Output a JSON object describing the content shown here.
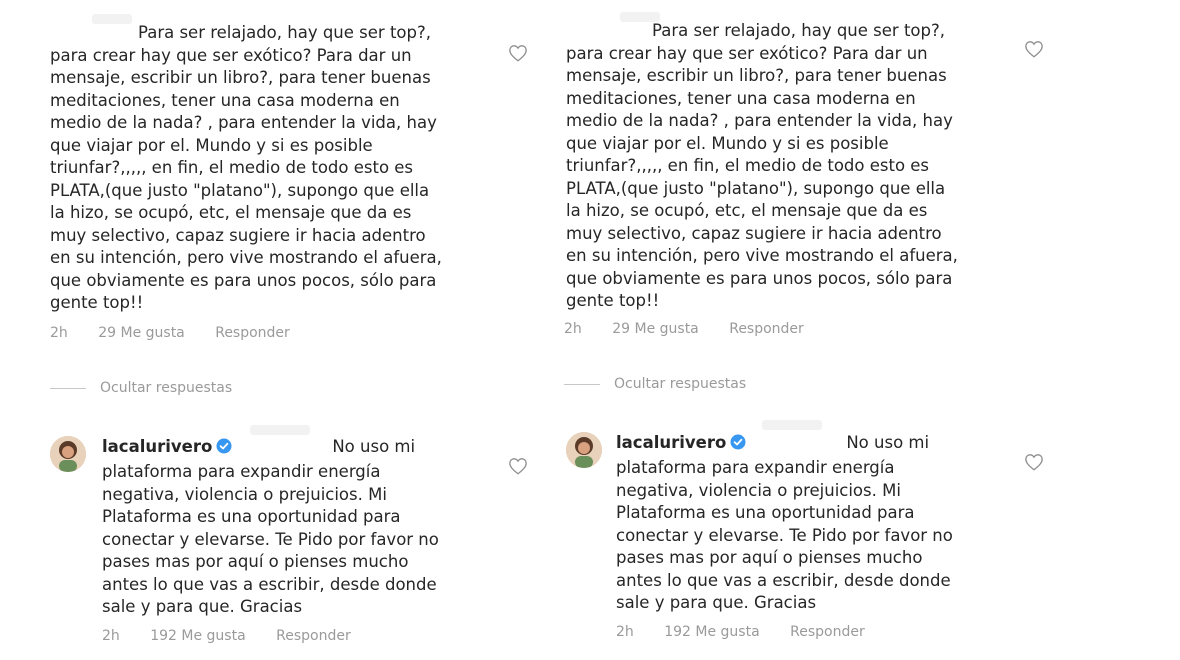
{
  "comment": {
    "intro": "Para ser relajado, hay que ser top?,",
    "text": "para crear hay que ser exótico? Para dar un\nmensaje, escribir un libro?, para tener buenas\nmeditaciones, tener una casa moderna en\nmedio de la nada? , para entender la vida, hay\nque viajar por el. Mundo y si es posible\ntriunfar?,,,,, en fin, el medio de todo esto es\nPLATA,(que justo \"platano\"), supongo que ella\nla hizo, se ocupó, etc, el mensaje que da es\nmuy selectivo, capaz sugiere ir hacia adentro\nen su intención, pero vive mostrando el afuera,\nque obviamente es para unos pocos, sólo para\ngente top!!",
    "time": "2h",
    "likes": "29 Me gusta",
    "reply_label": "Responder"
  },
  "hide_replies_label": "Ocultar respuestas",
  "reply": {
    "username": "lacalurivero",
    "first_line": "No uso mi",
    "text": "plataforma para expandir energía\nnegativa, violencia o prejuicios. Mi\nPlataforma es una oportunidad para\nconectar y elevarse. Te Pido por favor no\npases mas por aquí o pienses mucho\nantes lo que vas a escribir, desde donde\nsale y para que. Gracias",
    "time": "2h",
    "likes": "192 Me gusta",
    "reply_label": "Responder"
  },
  "colors": {
    "text": "#262626",
    "meta": "#9a9a9a",
    "verified": "#3897f0"
  }
}
